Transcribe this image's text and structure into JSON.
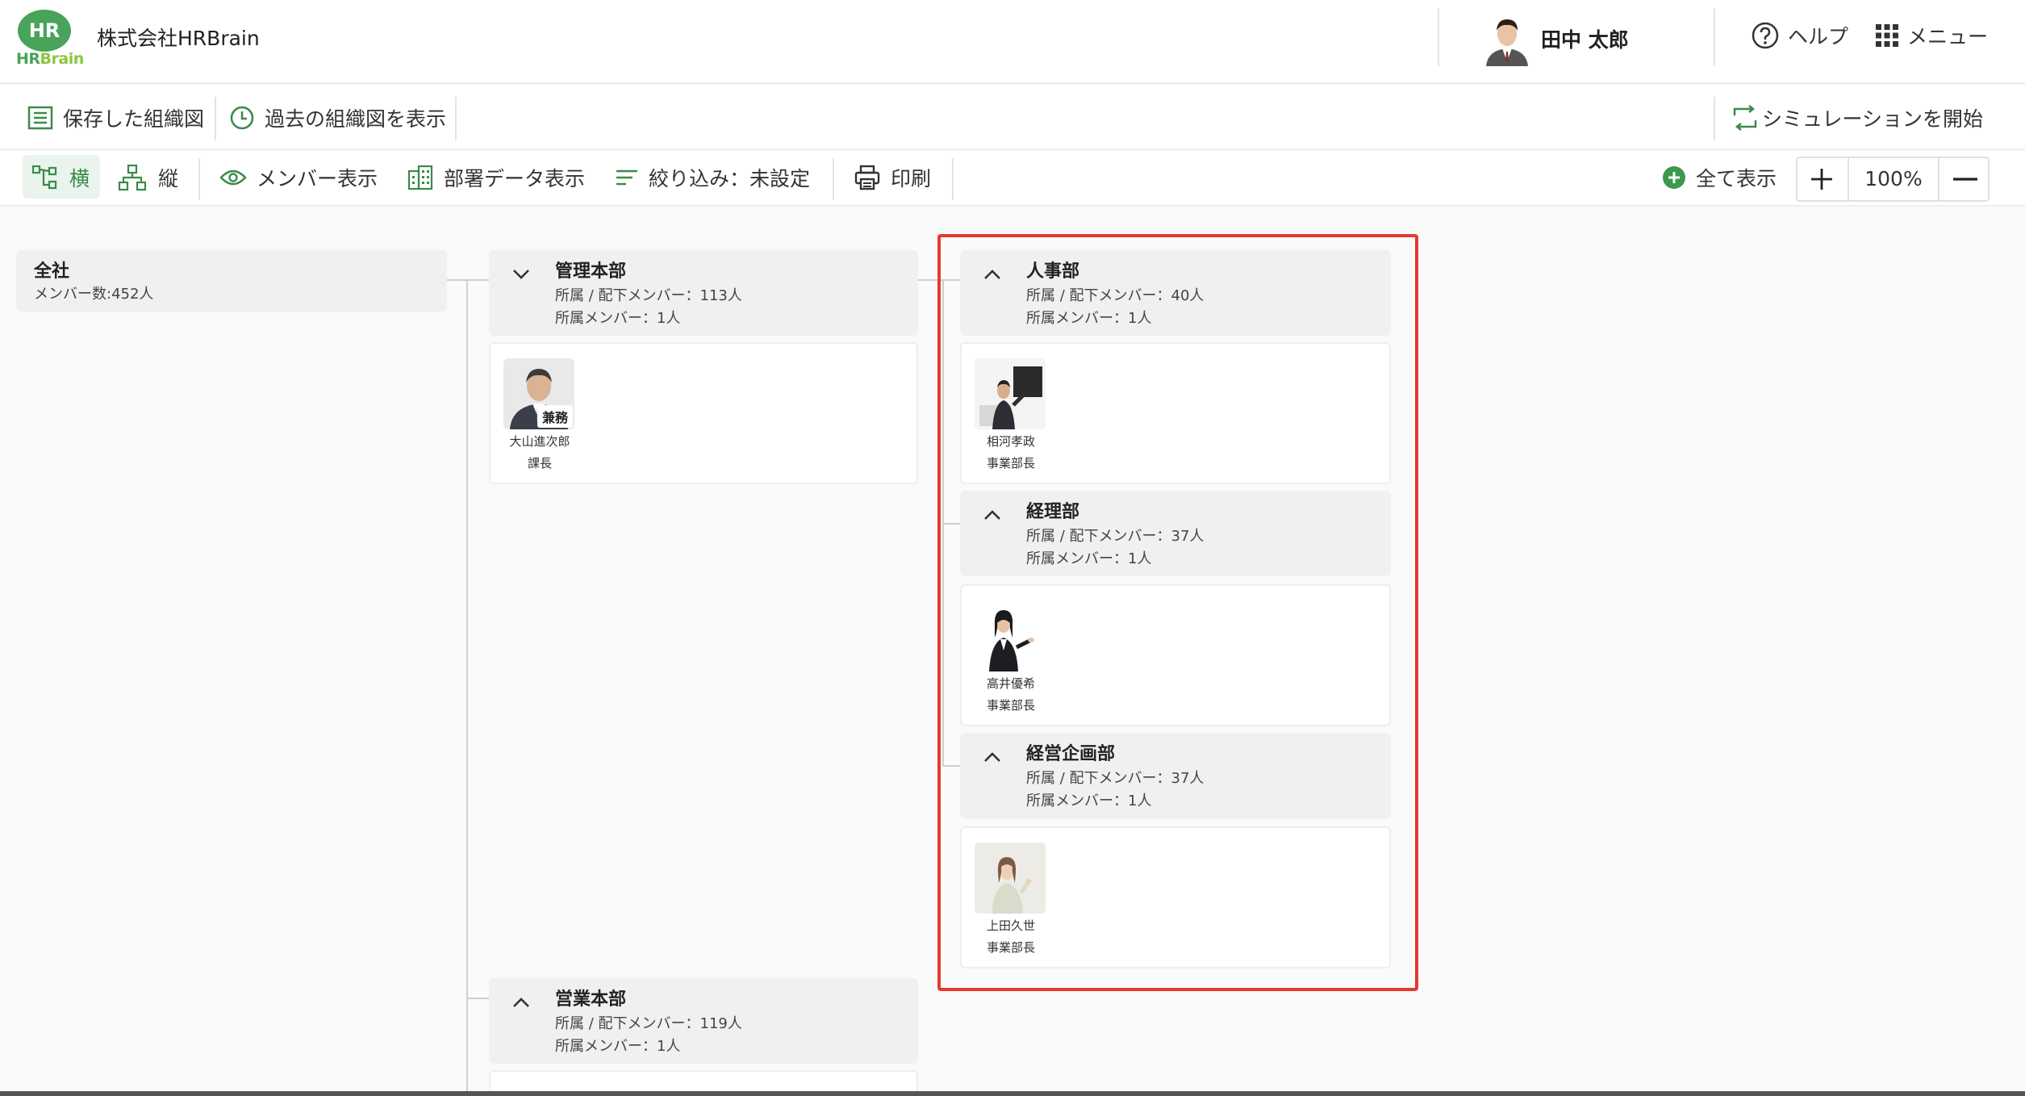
{
  "header": {
    "logo_mark": "HR",
    "logo_word_1": "HR",
    "logo_word_2": "Brain",
    "company": "株式会社HRBrain",
    "user_name": "田中 太郎",
    "help_label": "ヘルプ",
    "menu_label": "メニュー"
  },
  "toolbar1": {
    "saved_charts": "保存した組織図",
    "past_charts": "過去の組織図を表示",
    "simulation": "シミュレーションを開始"
  },
  "toolbar2": {
    "horizontal": "横",
    "vertical": "縦",
    "member_view": "メンバー表示",
    "dept_data_view": "部署データ表示",
    "filter": "絞り込み：未設定",
    "print": "印刷",
    "show_all": "全て表示",
    "zoom": "100%"
  },
  "org": {
    "root": {
      "name": "全社",
      "members": "メンバー数:452人"
    },
    "kanri": {
      "name": "管理本部",
      "line1": "所属 / 配下メンバー：113人",
      "line2": "所属メンバー：1人",
      "member": {
        "name": "大山進次郎",
        "title": "課長",
        "badge": "兼務"
      }
    },
    "jinji": {
      "name": "人事部",
      "line1": "所属 / 配下メンバー：40人",
      "line2": "所属メンバー：1人",
      "member": {
        "name": "相河孝政",
        "title": "事業部長"
      }
    },
    "keiri": {
      "name": "経理部",
      "line1": "所属 / 配下メンバー：37人",
      "line2": "所属メンバー：1人",
      "member": {
        "name": "高井優希",
        "title": "事業部長"
      }
    },
    "keiei": {
      "name": "経営企画部",
      "line1": "所属 / 配下メンバー：37人",
      "line2": "所属メンバー：1人",
      "member": {
        "name": "上田久世",
        "title": "事業部長"
      }
    },
    "eigyo": {
      "name": "営業本部",
      "line1": "所属 / 配下メンバー：119人",
      "line2": "所属メンバー：1人"
    }
  },
  "colors": {
    "brand": "#4aa35a",
    "highlight": "#e53a2f"
  }
}
